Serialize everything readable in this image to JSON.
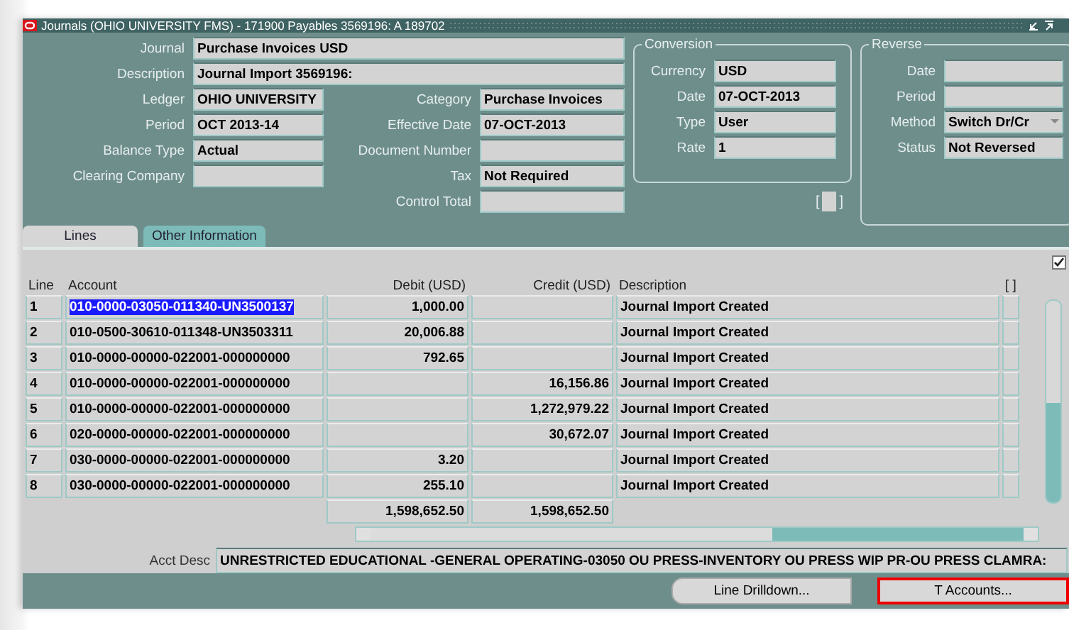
{
  "window": {
    "title": "Journals (OHIO UNIVERSITY FMS) - 171900 Payables 3569196: A 189702"
  },
  "header": {
    "journal": {
      "label": "Journal",
      "value": "Purchase Invoices USD"
    },
    "description": {
      "label": "Description",
      "value": "Journal Import 3569196:"
    },
    "left_fields": [
      {
        "label": "Ledger",
        "value": "OHIO UNIVERSITY"
      },
      {
        "label": "Period",
        "value": "OCT 2013-14"
      },
      {
        "label": "Balance Type",
        "value": "Actual"
      },
      {
        "label": "Clearing Company"
      }
    ],
    "right_fields": [
      {
        "label": "Category",
        "value": "Purchase Invoices"
      },
      {
        "label": "Effective Date",
        "value": "07-OCT-2013"
      },
      {
        "label": "Document Number"
      },
      {
        "label": "Tax",
        "value": "Not Required"
      },
      {
        "label": "Control Total"
      }
    ],
    "conversion": {
      "title": "Conversion",
      "fields": [
        {
          "label": "Currency",
          "value": "USD"
        },
        {
          "label": "Date",
          "value": "07-OCT-2013"
        },
        {
          "label": "Type",
          "value": "User"
        },
        {
          "label": "Rate",
          "value": "1"
        }
      ]
    },
    "flex_field": {
      "open": "[",
      "close": "]"
    },
    "reverse": {
      "title": "Reverse",
      "fields": [
        {
          "label": "Date",
          "dropdown": false
        },
        {
          "label": "Period",
          "dropdown": false
        },
        {
          "label": "Method",
          "value": "Switch Dr/Cr",
          "dropdown": true
        },
        {
          "label": "Status",
          "value": "Not Reversed",
          "dropdown": false
        }
      ]
    }
  },
  "tabs": [
    {
      "label": "Lines",
      "selected": true
    },
    {
      "label": "Other Information",
      "selected": false
    }
  ],
  "table": {
    "checked": true,
    "columns": [
      "Line",
      "Account",
      "Debit (USD)",
      "Credit (USD)",
      "Description",
      "[ ]"
    ],
    "rows": [
      {
        "line": "1",
        "account": "010-0000-03050-011340-UN3500137",
        "debit": "1,000.00",
        "credit": "",
        "description": "Journal Import Created",
        "selected": true
      },
      {
        "line": "2",
        "account": "010-0500-30610-011348-UN3503311",
        "debit": "20,006.88",
        "credit": "",
        "description": "Journal Import Created",
        "selected": false
      },
      {
        "line": "3",
        "account": "010-0000-00000-022001-000000000",
        "debit": "792.65",
        "credit": "",
        "description": "Journal Import Created",
        "selected": false
      },
      {
        "line": "4",
        "account": "010-0000-00000-022001-000000000",
        "debit": "",
        "credit": "16,156.86",
        "description": "Journal Import Created",
        "selected": false
      },
      {
        "line": "5",
        "account": "010-0000-00000-022001-000000000",
        "debit": "",
        "credit": "1,272,979.22",
        "description": "Journal Import Created",
        "selected": false
      },
      {
        "line": "6",
        "account": "020-0000-00000-022001-000000000",
        "debit": "",
        "credit": "30,672.07",
        "description": "Journal Import Created",
        "selected": false
      },
      {
        "line": "7",
        "account": "030-0000-00000-022001-000000000",
        "debit": "3.20",
        "credit": "",
        "description": "Journal Import Created",
        "selected": false
      },
      {
        "line": "8",
        "account": "030-0000-00000-022001-000000000",
        "debit": "255.10",
        "credit": "",
        "description": "Journal Import Created",
        "selected": false
      }
    ],
    "totals": {
      "debit": "1,598,652.50",
      "credit": "1,598,652.50"
    }
  },
  "acct_desc": {
    "label": "Acct Desc",
    "value": "UNRESTRICTED EDUCATIONAL -GENERAL OPERATING-03050 OU PRESS-INVENTORY OU PRESS WIP PR-OU PRESS CLAMRA:"
  },
  "buttons": [
    {
      "label": "Line Drilldown...",
      "focused": false
    },
    {
      "label": "T Accounts...",
      "focused": true
    }
  ]
}
